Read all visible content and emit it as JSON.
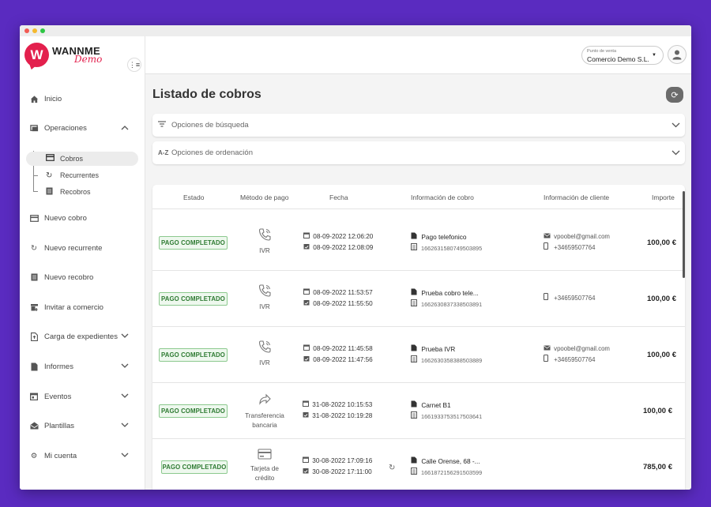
{
  "brand": {
    "name": "WANNME",
    "sub": "Demo",
    "mark": "W",
    "color": "#e3204d"
  },
  "window_dots": [
    "#f25b53",
    "#f5b92f",
    "#2ec644"
  ],
  "sidebar": {
    "collapse_icon": "menu-collapse-icon",
    "items": [
      {
        "label": "Inicio",
        "icon": "home-icon"
      },
      {
        "label": "Operaciones",
        "icon": "operations-icon",
        "chevron": "▲"
      },
      {
        "label": "Nuevo cobro",
        "icon": "card-icon"
      },
      {
        "label": "Nuevo recurrente",
        "icon": "recurrent-icon"
      },
      {
        "label": "Nuevo recobro",
        "icon": "document-icon"
      },
      {
        "label": "Invitar a comercio",
        "icon": "store-icon"
      },
      {
        "label": "Carga de expedientes",
        "icon": "upload-file-icon",
        "chevron": "▼"
      },
      {
        "label": "Informes",
        "icon": "report-icon",
        "chevron": "▼"
      },
      {
        "label": "Eventos",
        "icon": "calendar-icon",
        "chevron": "▼"
      },
      {
        "label": "Plantillas",
        "icon": "mail-icon",
        "chevron": "▼"
      },
      {
        "label": "Mi cuenta",
        "icon": "gear-icon",
        "chevron": "▼"
      }
    ],
    "subitems": [
      {
        "label": "Cobros",
        "icon": "card-icon",
        "active": true
      },
      {
        "label": "Recurrentes",
        "icon": "recurrent-icon"
      },
      {
        "label": "Recobros",
        "icon": "document-icon"
      }
    ]
  },
  "topbar": {
    "pos_label": "Punto de venta",
    "pos_value": "Comercio Demo S.L."
  },
  "page": {
    "title": "Listado de cobros",
    "search_label": "Opciones de búsqueda",
    "sort_label": "Opciones de ordenación",
    "sort_icon_text": "A-Z"
  },
  "table": {
    "headers": [
      "Estado",
      "Método de pago",
      "Fecha",
      "Información de cobro",
      "Información de cliente",
      "Importe"
    ],
    "rows": [
      {
        "status": "PAGO COMPLETADO",
        "method": [
          "IVR"
        ],
        "method_icon": "phone-icon",
        "date1": "08-09-2022 12:06:20",
        "date2": "08-09-2022 12:08:09",
        "concept": "Pago telefonico",
        "id": "1662631580749503895",
        "email": "vpoobel@gmail.com",
        "phone": "+34659507764",
        "amount": "100,00 €"
      },
      {
        "status": "PAGO COMPLETADO",
        "method": [
          "IVR"
        ],
        "method_icon": "phone-icon",
        "date1": "08-09-2022 11:53:57",
        "date2": "08-09-2022 11:55:50",
        "concept": "Prueba cobro tele...",
        "id": "1662630837338503891",
        "email": "",
        "phone": "+34659507764",
        "amount": "100,00 €"
      },
      {
        "status": "PAGO COMPLETADO",
        "method": [
          "IVR"
        ],
        "method_icon": "phone-icon",
        "date1": "08-09-2022 11:45:58",
        "date2": "08-09-2022 11:47:56",
        "concept": "Prueba IVR",
        "id": "1662630358388503889",
        "email": "vpoobel@gmail.com",
        "phone": "+34659507764",
        "amount": "100,00 €"
      },
      {
        "status": "PAGO COMPLETADO",
        "method": [
          "Transferencia",
          "bancaria"
        ],
        "method_icon": "transfer-icon",
        "date1": "31-08-2022 10:15:53",
        "date2": "31-08-2022 10:19:28",
        "concept": "Carnet B1",
        "id": "1661933753517503641",
        "email": "",
        "phone": "",
        "amount": "100,00 €"
      },
      {
        "status": "PAGO COMPLETADO",
        "method": [
          "Tarjeta de",
          "crédito"
        ],
        "method_icon": "credit-card-icon",
        "date1": "30-08-2022 17:09:16",
        "date2": "30-08-2022 17:11:00",
        "concept": "Calle Orense, 68 -...",
        "id": "1661872156291503599",
        "email": "",
        "phone": "",
        "amount": "785,00 €",
        "recurrent": true
      }
    ]
  }
}
